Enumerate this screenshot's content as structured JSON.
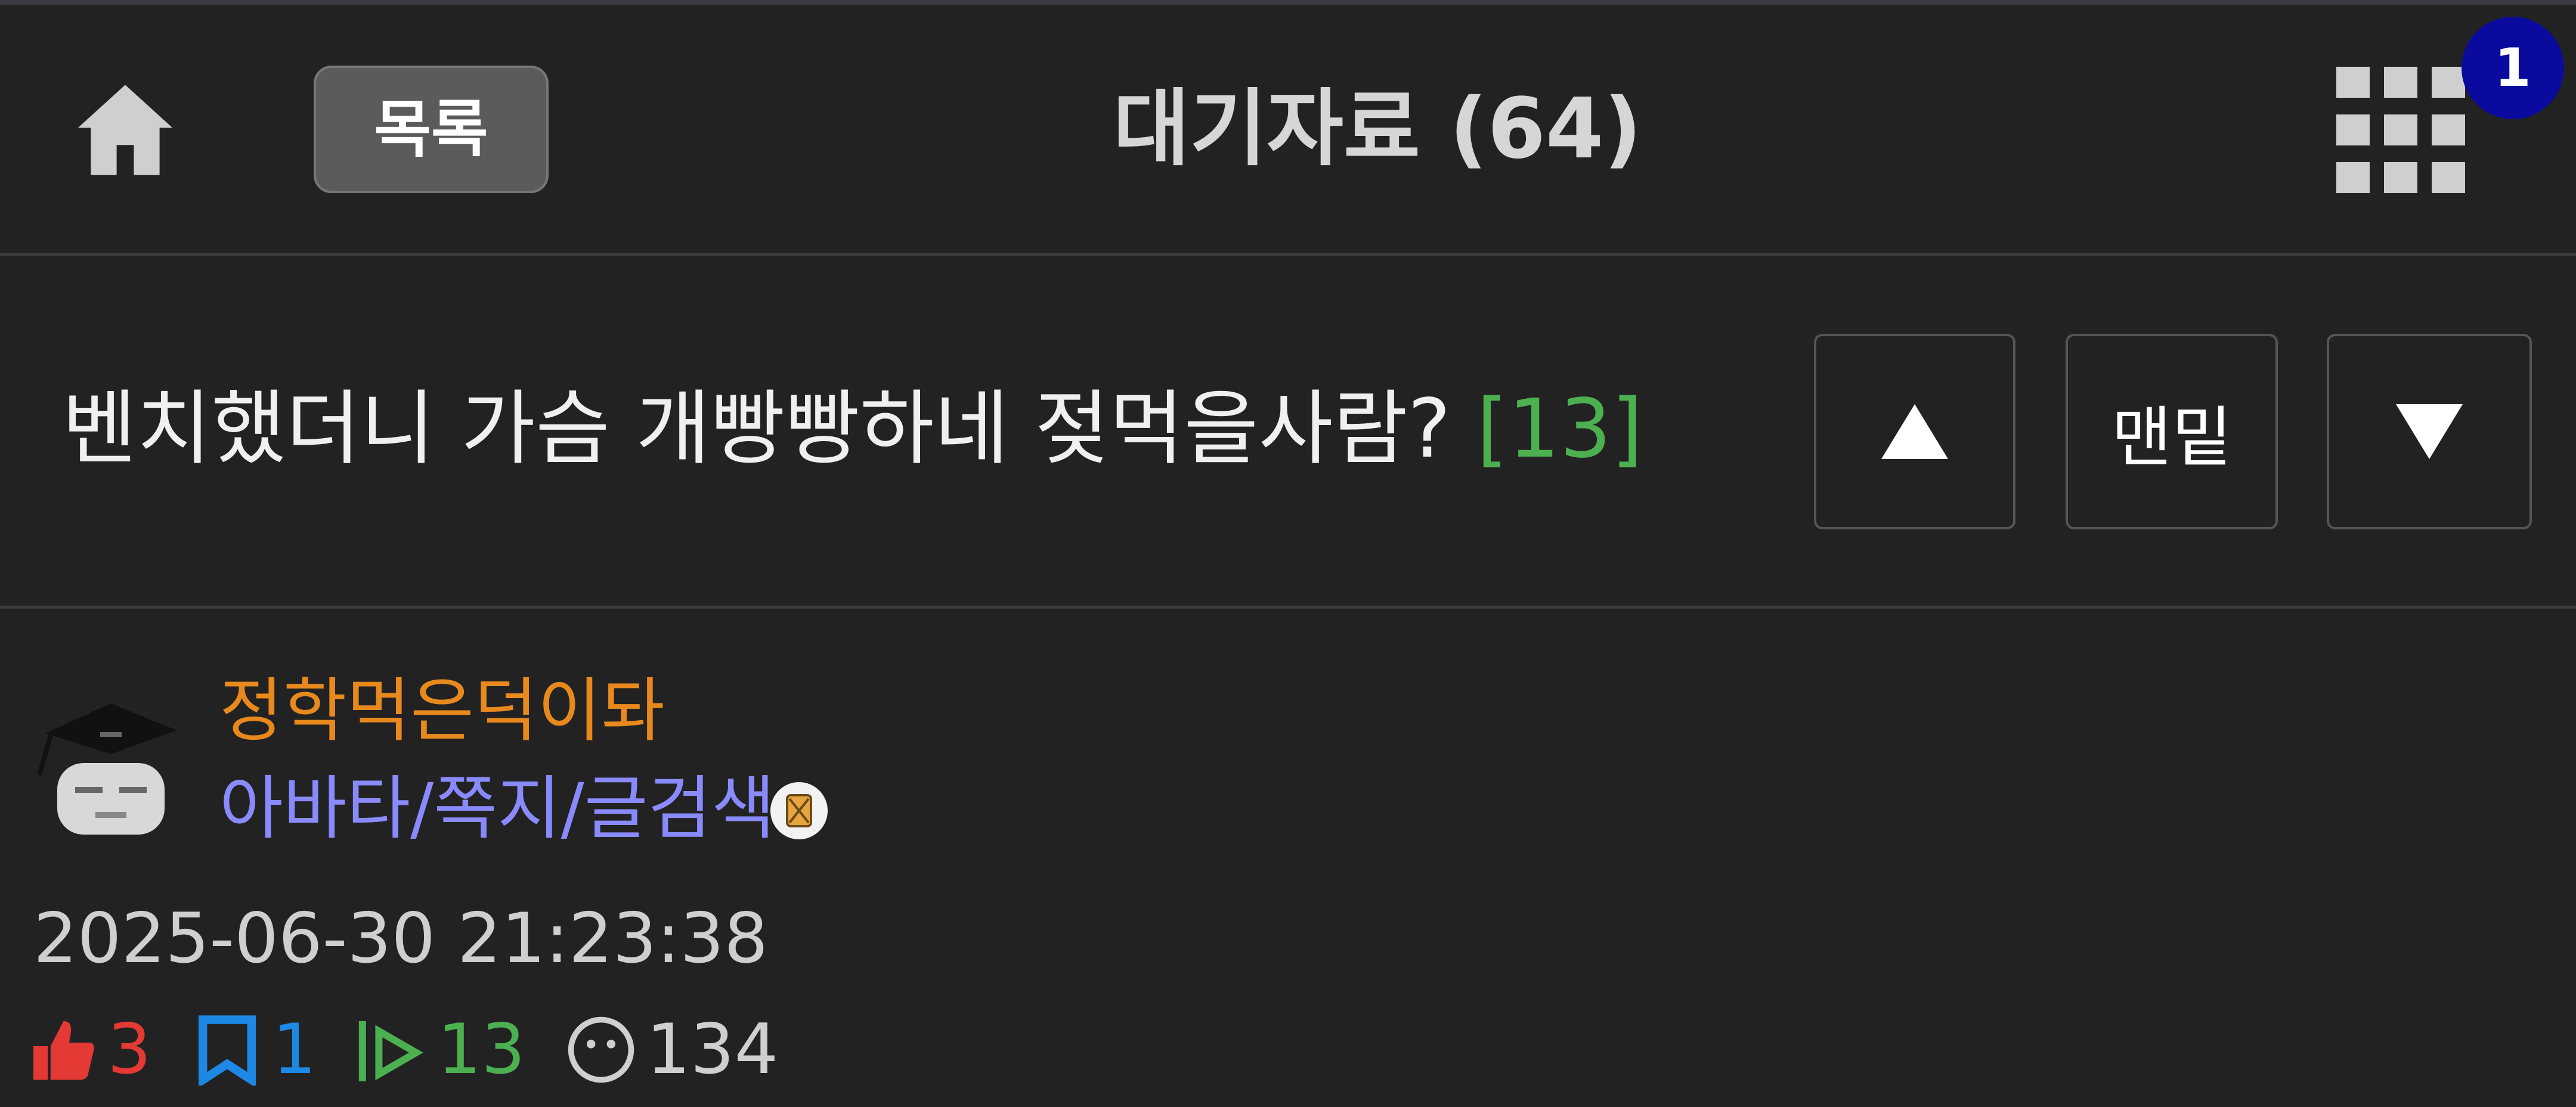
{
  "header": {
    "list_label": "목록",
    "title": "대기자료 (64)",
    "notification_count": "1"
  },
  "post": {
    "title": "벤치했더니 가슴 개빵빵하네 젖먹을사람?",
    "comment_count": "[13]",
    "nav": {
      "bottom_label": "맨밑"
    }
  },
  "author": {
    "name": "정학먹은덕이돠",
    "links": "아바타/쪽지/글검색"
  },
  "meta": {
    "timestamp": "2025-06-30 21:23:38",
    "likes": "3",
    "scraps": "1",
    "comments": "13",
    "views": "134"
  },
  "colors": {
    "background": "#222222",
    "author_name": "#e8891e",
    "author_links": "#8a8aff",
    "comment_count": "#4caf50",
    "like": "#e53935",
    "scrap": "#1e88e5",
    "comment": "#4caf50",
    "badge": "#0a0a9e"
  },
  "icons": {
    "home": "home-icon",
    "grid": "grid-menu-icon",
    "up": "up-arrow-icon",
    "down": "down-arrow-icon",
    "like": "thumbs-up-icon",
    "scrap": "bookmark-icon",
    "comment": "comment-icon",
    "views": "face-icon"
  }
}
